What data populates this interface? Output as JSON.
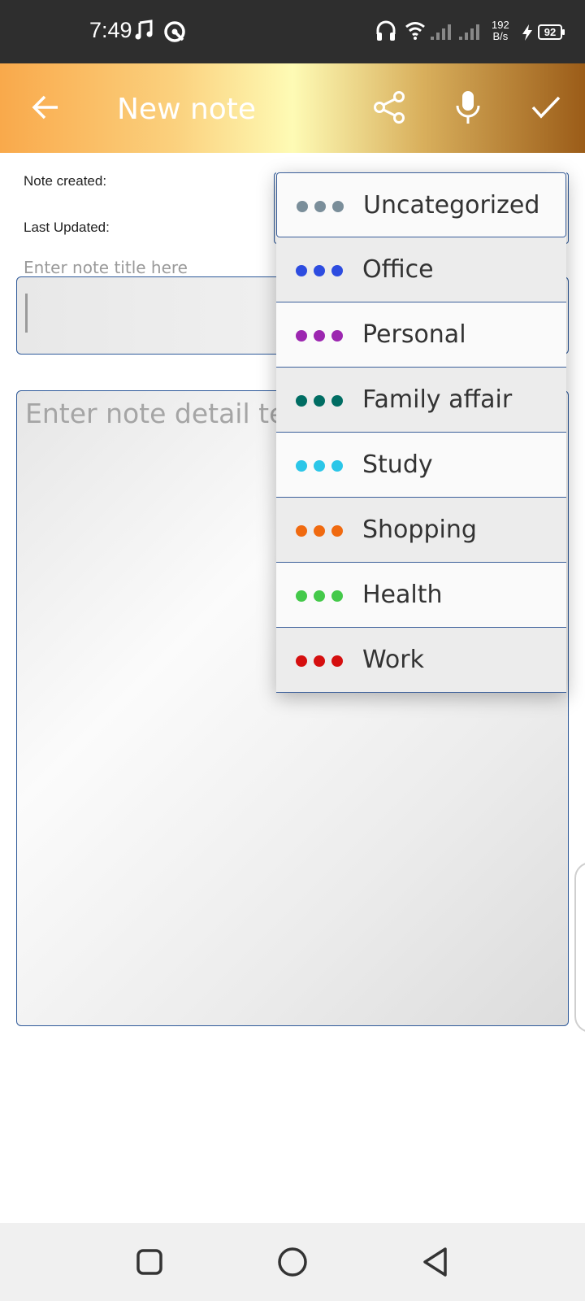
{
  "status_bar": {
    "time": "7:49",
    "net_speed_top": "192",
    "net_speed_bottom": "B/s",
    "battery": "92",
    "icons": [
      "music-note-icon",
      "target-icon",
      "headphones-icon",
      "wifi-icon",
      "signal-icon",
      "signal-icon",
      "charging-icon",
      "battery-icon"
    ]
  },
  "app_bar": {
    "title": "New note",
    "icons": [
      "back-arrow-icon",
      "share-icon",
      "microphone-icon",
      "check-icon"
    ]
  },
  "form": {
    "note_created_label": "Note created:",
    "last_updated_label": "Last Updated:",
    "title_hint": "Enter note title here",
    "detail_placeholder": "Enter note detail text"
  },
  "category_dropdown": {
    "items": [
      {
        "label": "Uncategorized",
        "color": "#7a8e9a"
      },
      {
        "label": "Office",
        "color": "#2d4ce0"
      },
      {
        "label": "Personal",
        "color": "#9c27b0"
      },
      {
        "label": "Family affair",
        "color": "#006d63"
      },
      {
        "label": "Study",
        "color": "#2bc6e8"
      },
      {
        "label": "Shopping",
        "color": "#f06a10"
      },
      {
        "label": "Health",
        "color": "#44c94a"
      },
      {
        "label": "Work",
        "color": "#d50f0f"
      }
    ]
  },
  "nav_bar": {
    "icons": [
      "recent-apps-icon",
      "home-icon",
      "back-icon"
    ]
  },
  "colors": {
    "appbar_gradient": [
      "#f9a94b",
      "#fefbb5",
      "#9b5c18"
    ],
    "input_border": "#2f5a9a"
  }
}
